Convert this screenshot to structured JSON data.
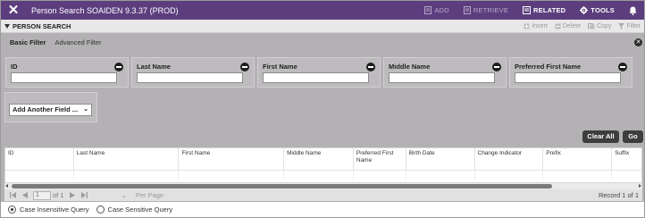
{
  "titlebar": {
    "close_icon": "close-icon",
    "title": "Person Search SOAIDEN 9.3.37 (PROD)",
    "actions": [
      {
        "label": "ADD",
        "icon": "add-doc-icon",
        "enabled": false
      },
      {
        "label": "RETRIEVE",
        "icon": "retrieve-icon",
        "enabled": false
      },
      {
        "label": "RELATED",
        "icon": "related-icon",
        "enabled": true
      },
      {
        "label": "TOOLS",
        "icon": "gear-icon",
        "enabled": true
      }
    ],
    "bell_icon": "bell-icon"
  },
  "section": {
    "title": "PERSON SEARCH",
    "actions": [
      {
        "label": "Insert",
        "icon": "plus-icon"
      },
      {
        "label": "Delete",
        "icon": "minus-icon"
      },
      {
        "label": "Copy",
        "icon": "copy-icon"
      },
      {
        "label": "Filter",
        "icon": "filter-icon"
      }
    ]
  },
  "filter": {
    "tabs": [
      "Basic Filter",
      "Advanced Filter"
    ],
    "active_tab": "Basic Filter",
    "fields": [
      {
        "label": "ID",
        "value": ""
      },
      {
        "label": "Last Name",
        "value": ""
      },
      {
        "label": "First Name",
        "value": ""
      },
      {
        "label": "Middle Name",
        "value": ""
      },
      {
        "label": "Preferred First Name",
        "value": ""
      }
    ],
    "add_field": {
      "label": "Add Another Field ..."
    }
  },
  "results": {
    "clear_all": "Clear All",
    "go": "Go",
    "columns": [
      "ID",
      "Last Name",
      "First Name",
      "Middle Name",
      "Preferred First Name",
      "Birth Date",
      "Change Indicator",
      "Prefix",
      "Suffix"
    ],
    "pager": {
      "page": "1",
      "of_label": "of 1",
      "per_page_label": "Per Page",
      "record_label": "Record 1 of 1"
    }
  },
  "query_mode": {
    "options": [
      "Case Insensitive Query",
      "Case Sensitive Query"
    ],
    "selected": "Case Insensitive Query"
  },
  "colors": {
    "titlebar_bg": "#5c3e7e",
    "panel_bg": "#b3b1b3",
    "button_bg": "#3d3d3d"
  }
}
